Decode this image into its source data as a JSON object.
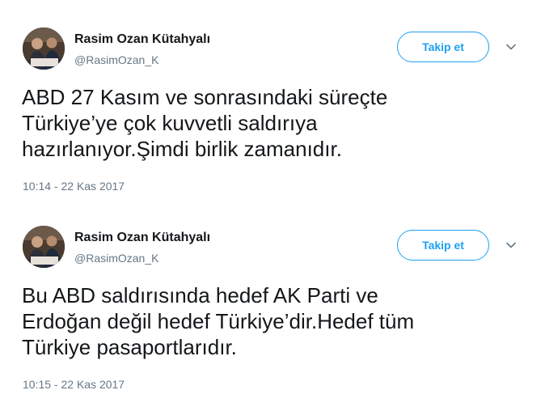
{
  "tweets": [
    {
      "author_name": "Rasim Ozan Kütahyalı",
      "author_handle": "@RasimOzan_K",
      "follow_label": "Takip et",
      "text_lines": [
        "ABD 27 Kasım ve sonrasındaki süreçte",
        "Türkiye’ye çok kuvvetli saldırıya",
        "hazırlanıyor.Şimdi birlik zamanıdır."
      ],
      "timestamp": "10:14 - 22 Kas 2017"
    },
    {
      "author_name": "Rasim Ozan Kütahyalı",
      "author_handle": "@RasimOzan_K",
      "follow_label": "Takip et",
      "text_lines": [
        "Bu ABD saldırısında hedef AK Parti ve",
        "Erdoğan değil hedef Türkiye’dir.Hedef tüm",
        "Türkiye pasaportlarıdır."
      ],
      "timestamp": "10:15 - 22 Kas 2017"
    }
  ],
  "colors": {
    "accent": "#1da1f2",
    "text_primary": "#14171a",
    "text_secondary": "#657786"
  },
  "icons": {
    "avatar": "profile-photo",
    "menu": "chevron-down-icon"
  }
}
